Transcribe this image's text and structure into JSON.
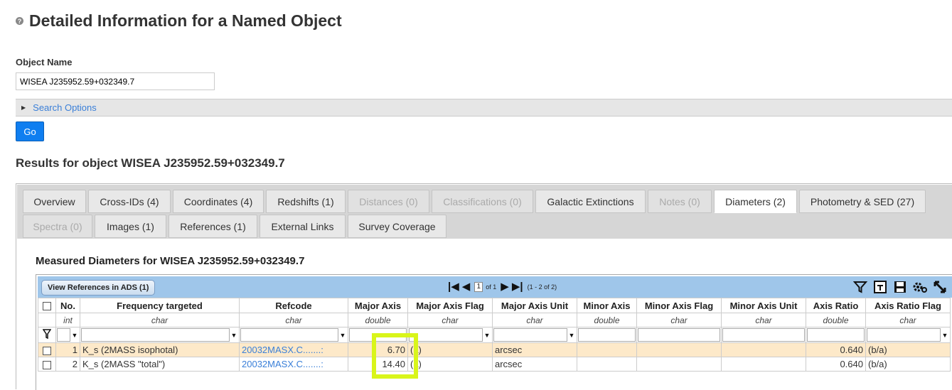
{
  "page": {
    "title": "Detailed Information for a Named Object",
    "help_icon": "?"
  },
  "form": {
    "object_name_label": "Object Name",
    "object_name_value": "WISEA J235952.59+032349.7",
    "search_options_label": "Search Options",
    "go_label": "Go"
  },
  "results": {
    "title": "Results for object WISEA J235952.59+032349.7"
  },
  "tabs": [
    {
      "label": "Overview",
      "state": "normal"
    },
    {
      "label": "Cross-IDs (4)",
      "state": "normal"
    },
    {
      "label": "Coordinates (4)",
      "state": "normal"
    },
    {
      "label": "Redshifts (1)",
      "state": "normal"
    },
    {
      "label": "Distances (0)",
      "state": "disabled"
    },
    {
      "label": "Classifications (0)",
      "state": "disabled"
    },
    {
      "label": "Galactic Extinctions",
      "state": "normal"
    },
    {
      "label": "Notes (0)",
      "state": "disabled"
    },
    {
      "label": "Diameters (2)",
      "state": "active"
    },
    {
      "label": "Photometry & SED (27)",
      "state": "normal"
    },
    {
      "label": "Spectra (0)",
      "state": "disabled"
    },
    {
      "label": "Images (1)",
      "state": "normal"
    },
    {
      "label": "References (1)",
      "state": "normal"
    },
    {
      "label": "External Links",
      "state": "normal"
    },
    {
      "label": "Survey Coverage",
      "state": "normal"
    }
  ],
  "diameters": {
    "title": "Measured Diameters for WISEA J235952.59+032349.7",
    "ads_button": "View References in ADS (1)",
    "pager": {
      "page": "1",
      "of_label": "of 1",
      "range_label": "(1 - 2 of 2)"
    },
    "tool_icons": [
      "filter-icon",
      "text-export-icon",
      "save-icon",
      "settings-icon",
      "expand-icon"
    ],
    "columns": [
      {
        "name": "No.",
        "type": "int"
      },
      {
        "name": "Frequency targeted",
        "type": "char"
      },
      {
        "name": "Refcode",
        "type": "char"
      },
      {
        "name": "Major Axis",
        "type": "double"
      },
      {
        "name": "Major Axis Flag",
        "type": "char"
      },
      {
        "name": "Major Axis Unit",
        "type": "char"
      },
      {
        "name": "Minor Axis",
        "type": "double"
      },
      {
        "name": "Minor Axis Flag",
        "type": "char"
      },
      {
        "name": "Minor Axis Unit",
        "type": "char"
      },
      {
        "name": "Axis Ratio",
        "type": "double"
      },
      {
        "name": "Axis Ratio Flag",
        "type": "char"
      }
    ],
    "rows": [
      {
        "no": "1",
        "freq": "K_s (2MASS isophotal)",
        "refcode": "20032MASX.C.......:",
        "major": "6.70",
        "major_flag": "(a)",
        "major_unit": "arcsec",
        "minor": "",
        "minor_flag": "",
        "minor_unit": "",
        "ratio": "0.640",
        "ratio_flag": "(b/a)"
      },
      {
        "no": "2",
        "freq": "K_s (2MASS \"total\")",
        "refcode": "20032MASX.C.......:",
        "major": "14.40",
        "major_flag": "(a)",
        "major_unit": "arcsec",
        "minor": "",
        "minor_flag": "",
        "minor_unit": "",
        "ratio": "0.640",
        "ratio_flag": "(b/a)"
      }
    ],
    "highlight_color": "#d9f51a"
  }
}
